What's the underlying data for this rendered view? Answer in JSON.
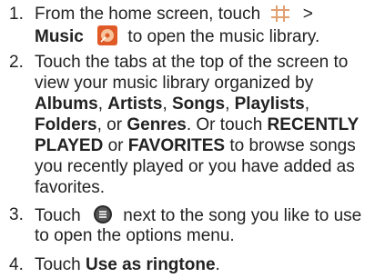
{
  "steps": [
    {
      "number": "1.",
      "line1_pre": "From the home screen, touch",
      "line1_post": ">",
      "line2_bold": "Music",
      "line2_post": "to open the music library."
    },
    {
      "number": "2.",
      "line1": "Touch the tabs at the top of the screen to",
      "line2": "view your music library organized by",
      "tab_albums": "Albums",
      "sep1": ",",
      "tab_artists": "Artists",
      "sep2": ",",
      "tab_songs": "Songs",
      "sep3": ",",
      "tab_playlists": "Playlists",
      "sep4": ",",
      "tab_folders": "Folders",
      "sep5": ", or",
      "tab_genres": "Genres",
      "line5_mid": ". Or touch",
      "recently": "RECENTLY",
      "played": "PLAYED",
      "line6_or": "or",
      "favorites": "FAVORITES",
      "line6_post": "to browse songs",
      "line7": "you recently played or you have added as",
      "line8": "favorites."
    },
    {
      "number": "3.",
      "line1_pre": "Touch",
      "line1_post": "next to the song you like to use",
      "line2": "to open the options menu."
    },
    {
      "number": "4.",
      "line1_pre": "Touch",
      "line1_bold": "Use as ringtone",
      "line1_post": "."
    }
  ],
  "icons": {
    "grid": "apps-grid-icon",
    "music": "music-app-icon",
    "menu": "options-menu-icon"
  },
  "colors": {
    "grid": "#e0a070",
    "music_bg": "#e05a28",
    "menu_bg": "#2a2a2a"
  }
}
